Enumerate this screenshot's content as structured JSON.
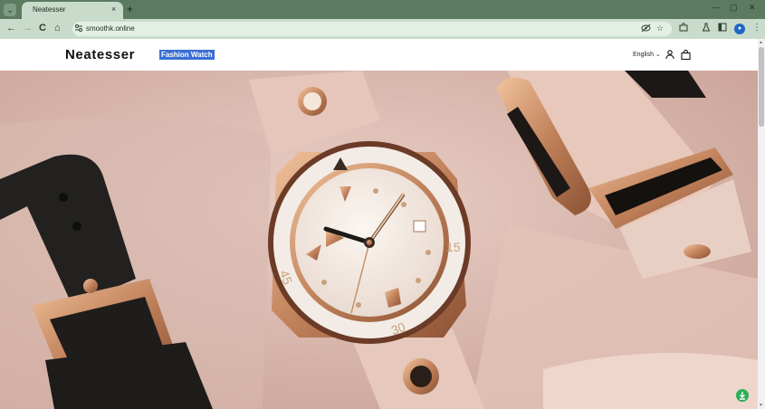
{
  "browser": {
    "tab": {
      "title": "Neatesser",
      "close": "×"
    },
    "new_tab": "+",
    "controls": {
      "minimize": "—",
      "maximize": "▢",
      "close": "✕"
    },
    "toolbar": {
      "back": "←",
      "forward": "→",
      "reload": "C",
      "home": "⌂",
      "url": "smoothk.online",
      "avatar": "●"
    }
  },
  "site": {
    "logo": "Neatesser",
    "tagline": "Fashion Watch",
    "language": "English ⌄"
  },
  "hero": {
    "watch_labels": {
      "n15": "15",
      "n30": "30",
      "n45": "45"
    },
    "colors": {
      "background": "#d9b7ae",
      "leather_pink": "#e8c8bd",
      "rose_gold": "#c98f68",
      "black_strap": "#1c1b1a",
      "dial": "#f2e9e2"
    }
  },
  "fab": {
    "icon": "download-icon"
  }
}
